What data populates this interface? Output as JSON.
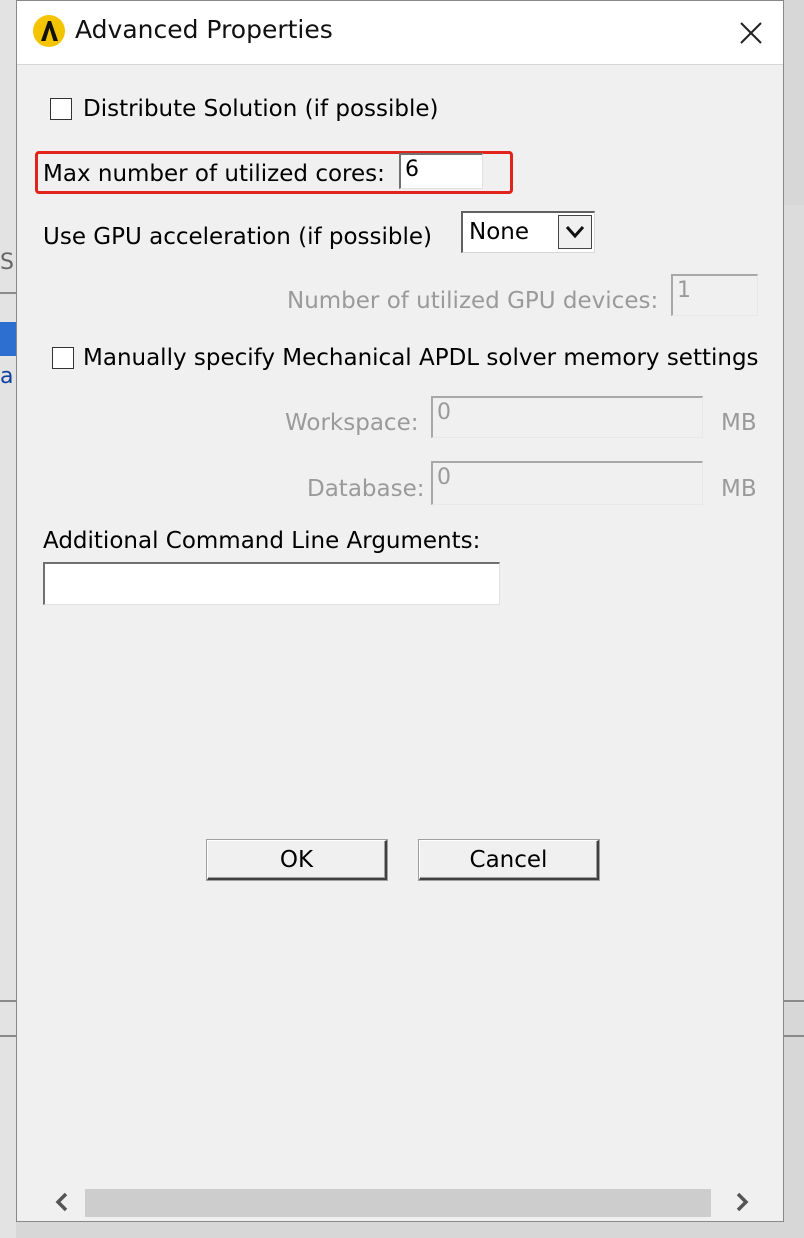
{
  "dialog": {
    "title": "Advanced Properties",
    "close_icon": "close-icon",
    "app_icon": "ansys-logo-icon"
  },
  "distribute": {
    "label": "Distribute Solution (if possible)",
    "checked": false
  },
  "max_cores": {
    "label": "Max number of utilized cores:",
    "value": "6"
  },
  "gpu": {
    "label": "Use GPU acceleration (if possible)",
    "selected": "None"
  },
  "gpu_devices": {
    "label": "Number of utilized GPU devices:",
    "value": "1"
  },
  "manual_memory": {
    "label": "Manually specify Mechanical APDL solver memory settings",
    "checked": false
  },
  "workspace": {
    "label": "Workspace:",
    "value": "0",
    "unit": "MB"
  },
  "database": {
    "label": "Database:",
    "value": "0",
    "unit": "MB"
  },
  "cmdline": {
    "label": "Additional Command Line Arguments:",
    "value": ""
  },
  "buttons": {
    "ok": "OK",
    "cancel": "Cancel"
  },
  "colors": {
    "highlight": "#e0231c",
    "dialog_bg": "#f0f0f0",
    "disabled_text": "#9a9a9a"
  }
}
